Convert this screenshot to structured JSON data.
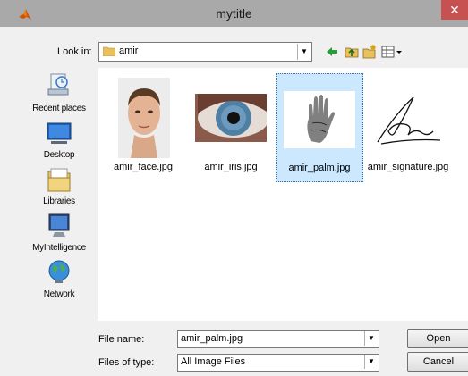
{
  "window": {
    "title": "mytitle",
    "close_glyph": "✕"
  },
  "look_in": {
    "label": "Look in:",
    "value": "amir"
  },
  "toolbar": {
    "back_icon": "back-arrow-icon",
    "up_icon": "up-folder-icon",
    "new_folder_icon": "new-folder-icon",
    "view_icon": "view-menu-icon"
  },
  "places": [
    {
      "label": "Recent places",
      "icon": "recent-places-icon"
    },
    {
      "label": "Desktop",
      "icon": "desktop-icon"
    },
    {
      "label": "Libraries",
      "icon": "libraries-icon"
    },
    {
      "label": "MyIntelligence",
      "icon": "computer-icon"
    },
    {
      "label": "Network",
      "icon": "network-icon"
    }
  ],
  "files": [
    {
      "name": "amir_face.jpg",
      "selected": false
    },
    {
      "name": "amir_iris.jpg",
      "selected": false
    },
    {
      "name": "amir_palm.jpg",
      "selected": true
    },
    {
      "name": "amir_signature.jpg",
      "selected": false
    }
  ],
  "file_name": {
    "label": "File name:",
    "value": "amir_palm.jpg"
  },
  "file_type": {
    "label": "Files of type:",
    "value": "All Image Files"
  },
  "buttons": {
    "open": "Open",
    "cancel": "Cancel"
  },
  "colors": {
    "title_bar": "#a9a9a9",
    "close": "#c75050",
    "selection": "#cce8ff"
  }
}
